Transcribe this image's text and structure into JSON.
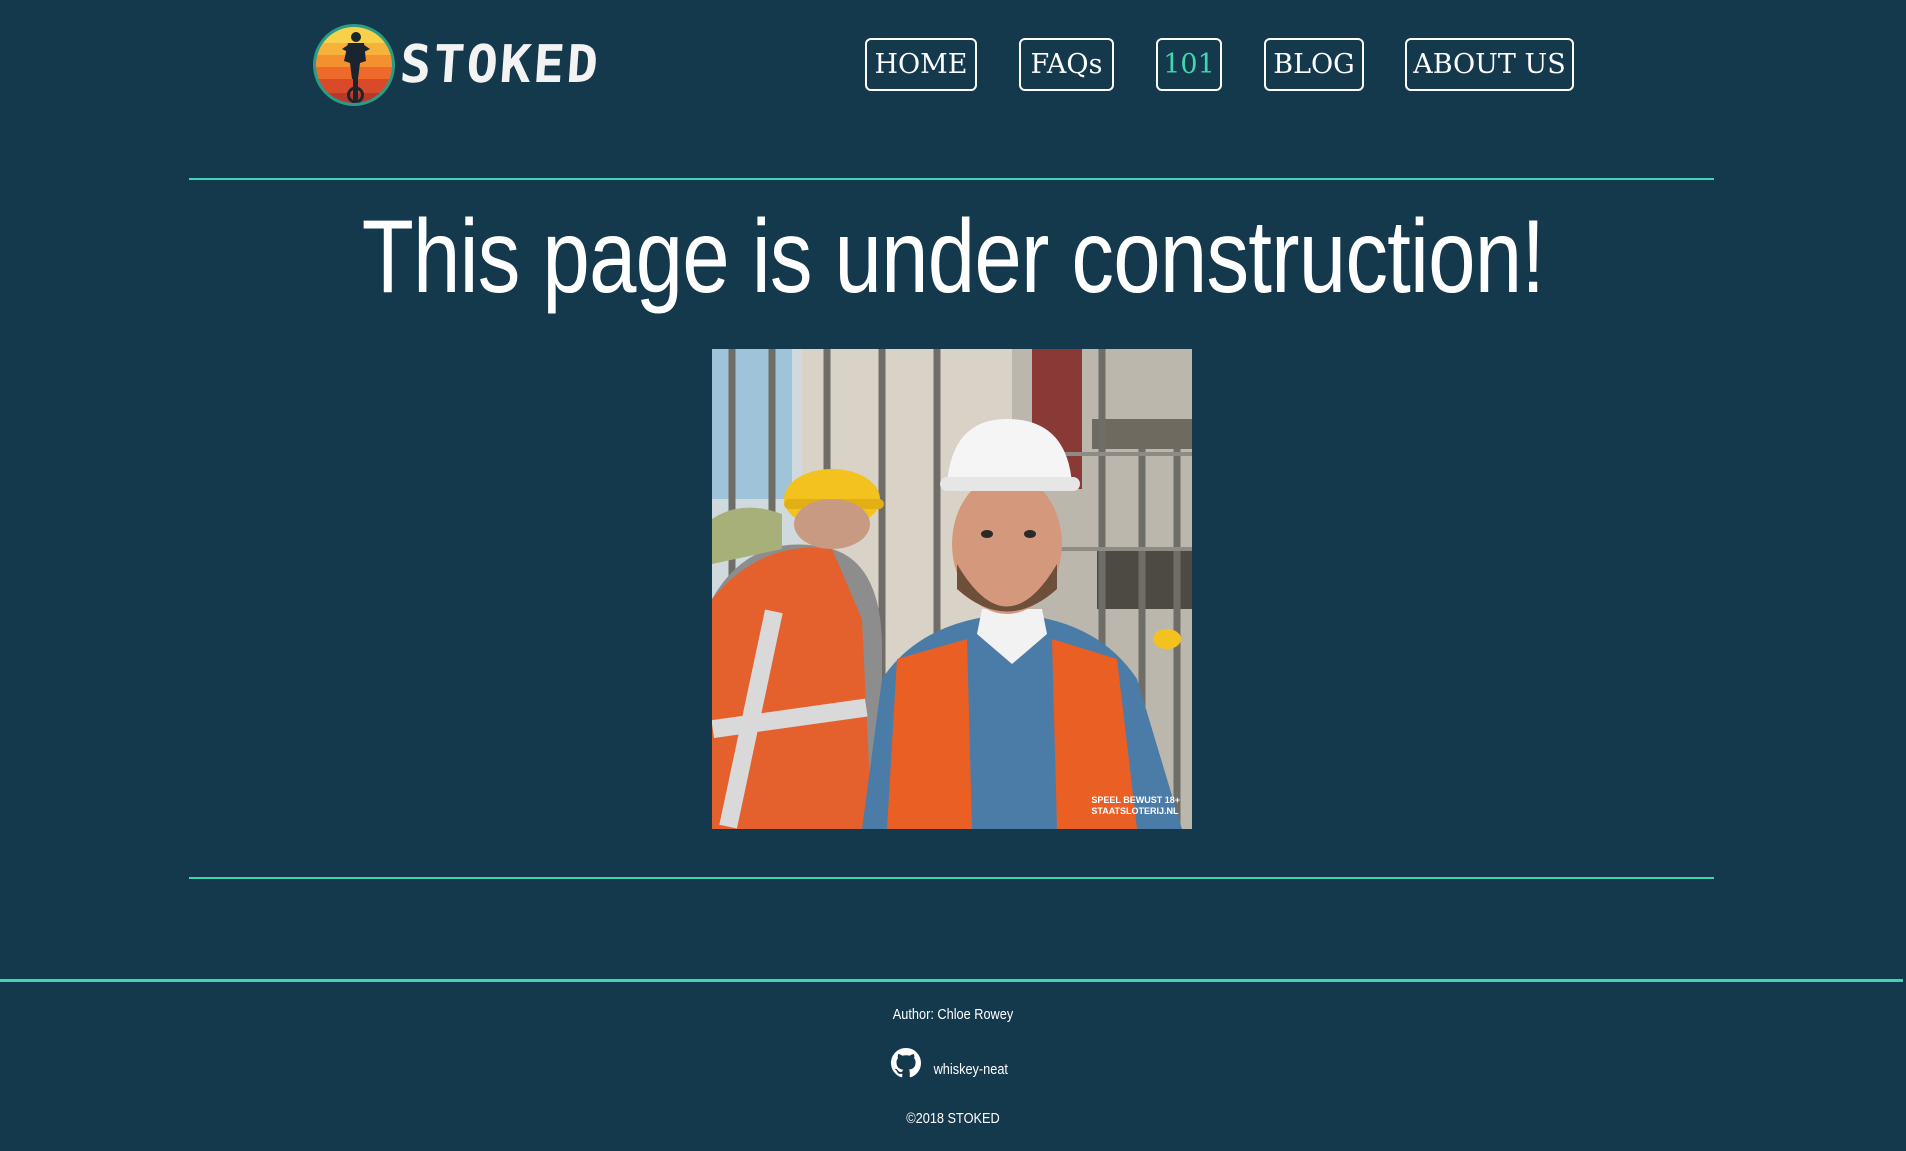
{
  "brand": {
    "name": "STOKED"
  },
  "nav": {
    "items": [
      {
        "label": "HOME"
      },
      {
        "label": "FAQs"
      },
      {
        "label": "101"
      },
      {
        "label": "BLOG"
      },
      {
        "label": "ABOUT US"
      }
    ],
    "active_index": 2
  },
  "main": {
    "title": "This page is under construction!",
    "image": {
      "overlay_line1": "SPEEL BEWUST 18+",
      "overlay_line2": "STAATSLOTERIJ.NL"
    }
  },
  "footer": {
    "author": "Author: Chloe Rowey",
    "github_user": "whiskey-neat",
    "copyright": "©2018 STOKED"
  },
  "colors": {
    "background": "#14384c",
    "accent": "#3fd6b0",
    "text": "#ffffff"
  },
  "icons": {
    "logo": "cyclist-sunset-badge",
    "github": "github-icon"
  }
}
